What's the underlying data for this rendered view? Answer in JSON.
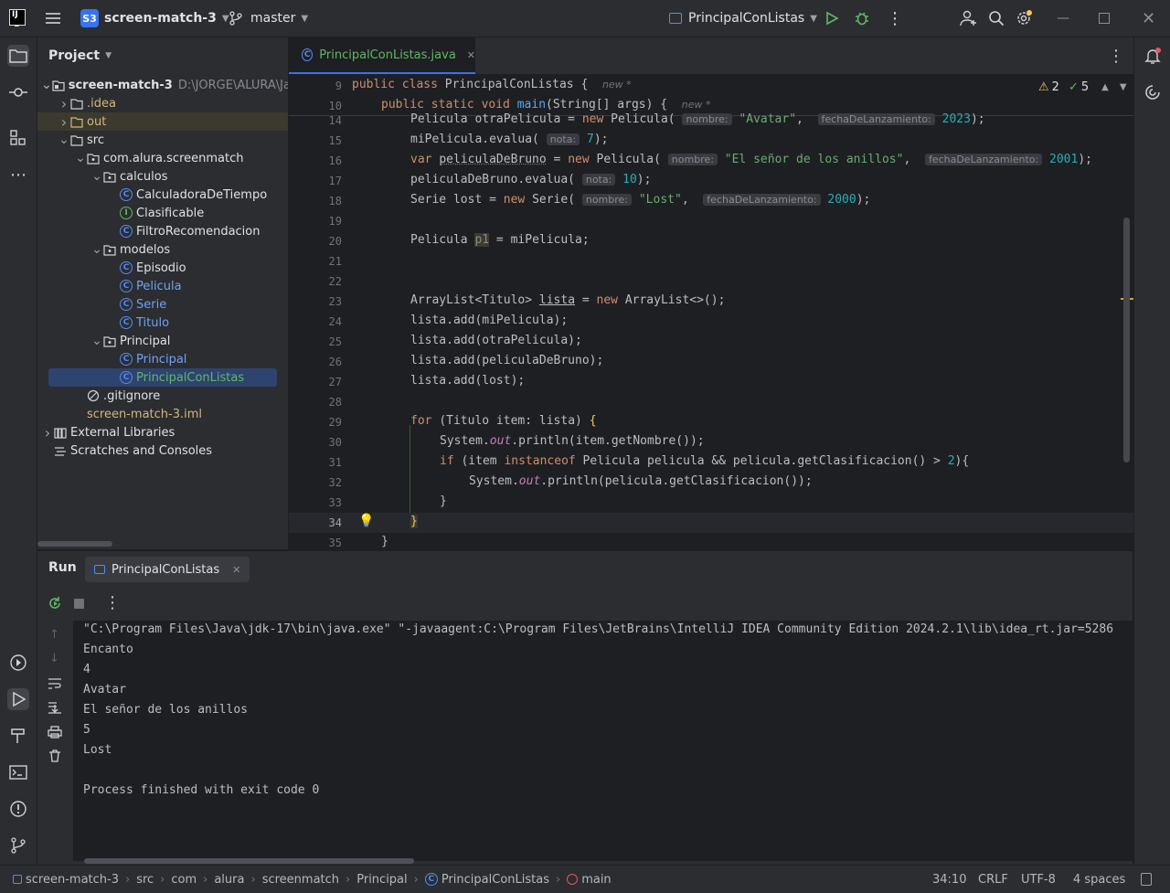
{
  "titlebar": {
    "project_badge": "S3",
    "project_name": "screen-match-3",
    "branch": "master",
    "run_config": "PrincipalConListas"
  },
  "project_panel": {
    "title": "Project",
    "root_name": "screen-match-3",
    "root_path": "D:\\JORGE\\ALURA\\Ja",
    "items": [
      {
        "label": "screen-match-3",
        "indent": 0,
        "kind": "module"
      },
      {
        "label": ".idea",
        "indent": 1,
        "kind": "folder"
      },
      {
        "label": "out",
        "indent": 1,
        "kind": "folder-excluded"
      },
      {
        "label": "src",
        "indent": 1,
        "kind": "folder"
      },
      {
        "label": "com.alura.screenmatch",
        "indent": 2,
        "kind": "package"
      },
      {
        "label": "calculos",
        "indent": 3,
        "kind": "package"
      },
      {
        "label": "CalculadoraDeTiempo",
        "indent": 4,
        "kind": "class"
      },
      {
        "label": "Clasificable",
        "indent": 4,
        "kind": "interface"
      },
      {
        "label": "FiltroRecomendacion",
        "indent": 4,
        "kind": "class"
      },
      {
        "label": "modelos",
        "indent": 3,
        "kind": "package"
      },
      {
        "label": "Episodio",
        "indent": 4,
        "kind": "class"
      },
      {
        "label": "Pelicula",
        "indent": 4,
        "kind": "class"
      },
      {
        "label": "Serie",
        "indent": 4,
        "kind": "class"
      },
      {
        "label": "Titulo",
        "indent": 4,
        "kind": "class"
      },
      {
        "label": "Principal",
        "indent": 3,
        "kind": "package"
      },
      {
        "label": "Principal",
        "indent": 4,
        "kind": "main-class"
      },
      {
        "label": "PrincipalConListas",
        "indent": 4,
        "kind": "main-class"
      },
      {
        "label": ".gitignore",
        "indent": 2,
        "kind": "ignore"
      },
      {
        "label": "screen-match-3.iml",
        "indent": 2,
        "kind": "iml"
      },
      {
        "label": "External Libraries",
        "indent": 0,
        "kind": "libraries"
      },
      {
        "label": "Scratches and Consoles",
        "indent": 0,
        "kind": "scratches"
      }
    ]
  },
  "editor": {
    "tab_label": "PrincipalConListas.java",
    "warnings": "2",
    "checks": "5",
    "new_hint": "new *",
    "param_hints": {
      "nombre": "nombre:",
      "fecha": "fechaDeLanzamiento:",
      "nota": "nota:"
    },
    "line_numbers": [
      "9",
      "10",
      "14",
      "15",
      "16",
      "17",
      "18",
      "19",
      "20",
      "21",
      "22",
      "23",
      "24",
      "25",
      "26",
      "27",
      "28",
      "29",
      "30",
      "31",
      "32",
      "33",
      "34",
      "35"
    ]
  },
  "run_panel": {
    "title": "Run",
    "tab_label": "PrincipalConListas",
    "output": [
      "\"C:\\Program Files\\Java\\jdk-17\\bin\\java.exe\" \"-javaagent:C:\\Program Files\\JetBrains\\IntelliJ IDEA Community Edition 2024.2.1\\lib\\idea_rt.jar=5286",
      "Encanto",
      "4",
      "Avatar",
      "El señor de los anillos",
      "5",
      "Lost",
      "",
      "Process finished with exit code 0"
    ]
  },
  "statusbar": {
    "breadcrumbs": [
      "screen-match-3",
      "src",
      "com",
      "alura",
      "screenmatch",
      "Principal",
      "PrincipalConListas",
      "main"
    ],
    "position": "34:10",
    "line_sep": "CRLF",
    "encoding": "UTF-8",
    "indent": "4 spaces"
  },
  "colors": {
    "accent": "#3574f0",
    "selection": "#2e436e",
    "excluded_folder": "#d5b778"
  }
}
